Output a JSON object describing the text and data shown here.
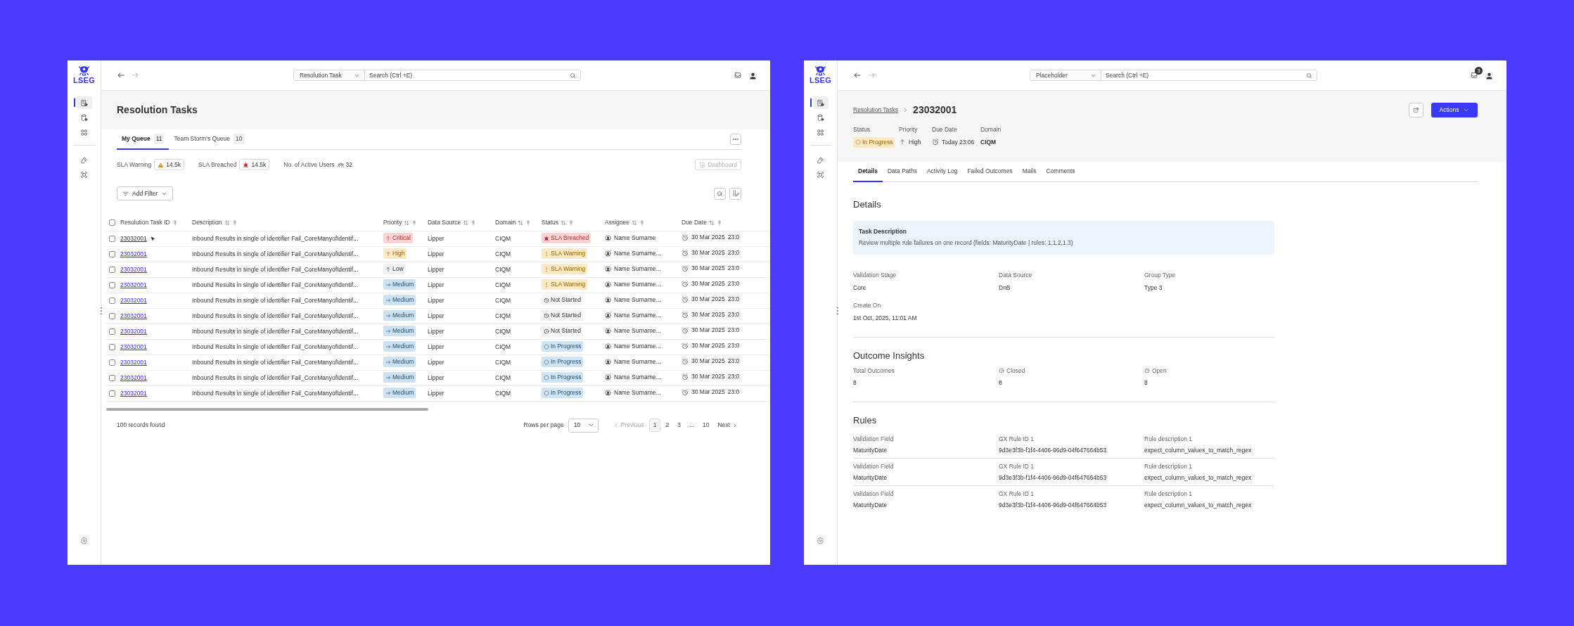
{
  "left_window": {
    "sidebar": {
      "logo": "LSEG",
      "groups": [
        {
          "items": [
            {
              "kind": "list",
              "selected": true
            },
            {
              "kind": "database",
              "selected": false
            },
            {
              "kind": "grid",
              "selected": false
            }
          ]
        },
        {
          "items": [
            {
              "kind": "gavel",
              "selected": false
            },
            {
              "kind": "scan",
              "selected": false
            }
          ]
        }
      ]
    },
    "topbar": {
      "scope": "Resolution Task",
      "search_placeholder": "Search (Ctrl +E)"
    },
    "title": "Resolution Tasks",
    "tabs": [
      {
        "label": "My Queue",
        "count": "11",
        "selected": true
      },
      {
        "label": "Team Storm's Queue",
        "count": "10",
        "selected": false
      }
    ],
    "stats": [
      {
        "kind": "warning",
        "label": "SLA Warning",
        "value": "14.5k"
      },
      {
        "kind": "breached",
        "label": "SLA Breached",
        "value": "14.5k"
      },
      {
        "kind": "users",
        "label": "No. of Active Users",
        "value": "32"
      }
    ],
    "dashboard_button": {
      "label": "Dashboard",
      "disabled": true
    },
    "filter_button": "Add Filter",
    "table": {
      "select_all_checked": false,
      "columns": [
        {
          "label": "Resolution Task ID",
          "sortable": false
        },
        {
          "label": "Description",
          "sortable": true
        },
        {
          "label": "Priority",
          "sortable": true
        },
        {
          "label": "Data Source",
          "sortable": true
        },
        {
          "label": "Domain",
          "sortable": true
        },
        {
          "label": "Status",
          "sortable": true
        },
        {
          "label": "Assignee",
          "sortable": true
        },
        {
          "label": "Due Date",
          "sortable": true
        }
      ],
      "rows": [
        {
          "checked": false,
          "hovered": true,
          "id": "23032001",
          "description": "Inbound Results in single of identifier Fail_CoreManyofIdentif...",
          "priority": {
            "kind": "critical",
            "label": "Critical"
          },
          "data_source": "Lipper",
          "domain": "CIQM",
          "status": {
            "kind": "breached",
            "label": "SLA Breached"
          },
          "assignee": "Name Surname",
          "due_date": "30 Mar 2025",
          "due_time": "23:0"
        },
        {
          "checked": false,
          "hovered": false,
          "id": "23032001",
          "description": "Inbound Results in single of identifier Fail_CoreManyofIdentif...",
          "priority": {
            "kind": "high",
            "label": "High"
          },
          "data_source": "Lipper",
          "domain": "CIQM",
          "status": {
            "kind": "warning",
            "label": "SLA Warning"
          },
          "assignee": "Name Surname...",
          "due_date": "30 Mar 2025",
          "due_time": "23:0"
        },
        {
          "checked": false,
          "hovered": false,
          "id": "23032001",
          "description": "Inbound Results in single of identifier Fail_CoreManyofIdentif...",
          "priority": {
            "kind": "low",
            "label": "Low"
          },
          "data_source": "Lipper",
          "domain": "CIQM",
          "status": {
            "kind": "warning",
            "label": "SLA Warning"
          },
          "assignee": "Name Surname...",
          "due_date": "30 Mar 2025",
          "due_time": "23:0"
        },
        {
          "checked": false,
          "hovered": false,
          "id": "23032001",
          "description": "Inbound Results in single of identifier Fail_CoreManyofIdentif...",
          "priority": {
            "kind": "medium",
            "label": "Medium"
          },
          "data_source": "Lipper",
          "domain": "CIQM",
          "status": {
            "kind": "warning",
            "label": "SLA Warning"
          },
          "assignee": "Name Surname...",
          "due_date": "30 Mar 2025",
          "due_time": "23:0"
        },
        {
          "checked": false,
          "hovered": false,
          "id": "23032001",
          "description": "Inbound Results in single of identifier Fail_CoreManyofIdentif...",
          "priority": {
            "kind": "medium",
            "label": "Medium"
          },
          "data_source": "Lipper",
          "domain": "CIQM",
          "status": {
            "kind": "not_started",
            "label": "Not Started"
          },
          "assignee": "Name Surname...",
          "due_date": "30 Mar 2025",
          "due_time": "23:0"
        },
        {
          "checked": false,
          "hovered": false,
          "id": "23032001",
          "description": "Inbound Results in single of identifier Fail_CoreManyofIdentif...",
          "priority": {
            "kind": "medium",
            "label": "Medium"
          },
          "data_source": "Lipper",
          "domain": "CIQM",
          "status": {
            "kind": "not_started",
            "label": "Not Started"
          },
          "assignee": "Name Surname...",
          "due_date": "30 Mar 2025",
          "due_time": "23:0"
        },
        {
          "checked": false,
          "hovered": false,
          "id": "23032001",
          "description": "Inbound Results in single of identifier Fail_CoreManyofIdentif...",
          "priority": {
            "kind": "medium",
            "label": "Medium"
          },
          "data_source": "Lipper",
          "domain": "CIQM",
          "status": {
            "kind": "not_started",
            "label": "Not Started"
          },
          "assignee": "Name Surname...",
          "due_date": "30 Mar 2025",
          "due_time": "23:0"
        },
        {
          "checked": false,
          "hovered": false,
          "id": "23032001",
          "description": "Inbound Results in single of identifier Fail_CoreManyofIdentif...",
          "priority": {
            "kind": "medium",
            "label": "Medium"
          },
          "data_source": "Lipper",
          "domain": "CIQM",
          "status": {
            "kind": "in_progress",
            "label": "In Progress"
          },
          "assignee": "Name Surname...",
          "due_date": "30 Mar 2025",
          "due_time": "23:0"
        },
        {
          "checked": false,
          "hovered": false,
          "id": "23032001",
          "description": "Inbound Results in single of identifier Fail_CoreManyofIdentif...",
          "priority": {
            "kind": "medium",
            "label": "Medium"
          },
          "data_source": "Lipper",
          "domain": "CIQM",
          "status": {
            "kind": "in_progress",
            "label": "In Progress"
          },
          "assignee": "Name Surname...",
          "due_date": "30 Mar 2025",
          "due_time": "23:0"
        },
        {
          "checked": false,
          "hovered": false,
          "id": "23032001",
          "description": "Inbound Results in single of identifier Fail_CoreManyofIdentif...",
          "priority": {
            "kind": "medium",
            "label": "Medium"
          },
          "data_source": "Lipper",
          "domain": "CIQM",
          "status": {
            "kind": "in_progress",
            "label": "In Progress"
          },
          "assignee": "Name Surname...",
          "due_date": "30 Mar 2025",
          "due_time": "23:0"
        },
        {
          "checked": false,
          "hovered": false,
          "id": "23032001",
          "description": "Inbound Results in single of identifier Fail_CoreManyofIdentif...",
          "priority": {
            "kind": "medium",
            "label": "Medium"
          },
          "data_source": "Lipper",
          "domain": "CIQM",
          "status": {
            "kind": "in_progress",
            "label": "In Progress"
          },
          "assignee": "Name Surname...",
          "due_date": "30 Mar 2025",
          "due_time": "23:0"
        }
      ]
    },
    "records": "100 records found",
    "pagination": {
      "rows_per_page_label": "Rows per page",
      "rows_per_page": "10",
      "previous": "Previous",
      "pages": [
        {
          "label": "1",
          "selected": true
        },
        {
          "label": "2",
          "selected": false
        },
        {
          "label": "3",
          "selected": false
        },
        {
          "label": "...",
          "selected": false
        },
        {
          "label": "10",
          "selected": false
        }
      ],
      "next": "Next"
    }
  },
  "right_window": {
    "sidebar": {
      "logo": "LSEG",
      "groups": [
        {
          "items": [
            {
              "kind": "list",
              "selected": true
            },
            {
              "kind": "database",
              "selected": false
            },
            {
              "kind": "grid",
              "selected": false
            }
          ]
        },
        {
          "items": [
            {
              "kind": "gavel",
              "selected": false
            },
            {
              "kind": "scan",
              "selected": false
            }
          ]
        }
      ]
    },
    "topbar": {
      "scope": "Placeholder",
      "search_placeholder": "Search (Ctrl +E)",
      "notification_count": "3"
    },
    "breadcrumb": {
      "parent": "Resolution Tasks",
      "current": "23032001"
    },
    "actions_button": "Actions",
    "summary": [
      {
        "kind": "status",
        "label": "Status",
        "value": "In Progress"
      },
      {
        "kind": "priority",
        "label": "Priority",
        "value": "High"
      },
      {
        "kind": "due",
        "label": "Due Date",
        "value": "Today 23:06"
      },
      {
        "kind": "plain",
        "label": "Domain",
        "value": "CIQM"
      }
    ],
    "tabs": [
      {
        "label": "Details",
        "selected": true
      },
      {
        "label": "Data Paths",
        "selected": false
      },
      {
        "label": "Activity Log",
        "selected": false
      },
      {
        "label": "Failed Outcomes",
        "selected": false
      },
      {
        "label": "Mails",
        "selected": false
      },
      {
        "label": "Comments",
        "selected": false
      }
    ],
    "details": {
      "heading": "Details",
      "task_description": {
        "title": "Task Description",
        "text": "Review multiple rule failures on one record (fields: MaturityDate | rules: 1,1.2,1.3)"
      },
      "fields": [
        {
          "label": "Validation Stage",
          "value": "Core"
        },
        {
          "label": "Data Source",
          "value": "DnB"
        },
        {
          "label": "Group Type",
          "value": "Type 3"
        },
        {
          "label": "Create On",
          "value": "1st Oct, 2025, 11:01 AM"
        }
      ]
    },
    "outcome_insights": {
      "heading": "Outcome Insights",
      "items": [
        {
          "kind": "total",
          "label": "Total Outcomes",
          "value": "8"
        },
        {
          "kind": "closed",
          "label": "Closed",
          "value": "8"
        },
        {
          "kind": "open",
          "label": "Open",
          "value": "8"
        }
      ]
    },
    "rules": {
      "heading": "Rules",
      "rows": [
        {
          "fields": [
            {
              "label": "Validation Field",
              "value": "MaturityDate"
            },
            {
              "label": "GX Rule ID 1",
              "value": "9d3e3f3b-f1f4-4406-96d9-04f647664b53"
            },
            {
              "label": "Rule description 1",
              "value": "expect_column_values_to_match_regex"
            }
          ]
        },
        {
          "fields": [
            {
              "label": "Validation Field",
              "value": "MaturityDate"
            },
            {
              "label": "GX Rule ID 1",
              "value": "9d3e3f3b-f1f4-4406-96d9-04f647664b53"
            },
            {
              "label": "Rule description 1",
              "value": "expect_column_values_to_match_regex"
            }
          ]
        },
        {
          "fields": [
            {
              "label": "Validation Field",
              "value": "MaturityDate"
            },
            {
              "label": "GX Rule ID 1",
              "value": "9d3e3f3b-f1f4-4406-96d9-04f647664b53"
            },
            {
              "label": "Rule description 1",
              "value": "expect_column_values_to_match_regex"
            }
          ]
        }
      ]
    }
  }
}
